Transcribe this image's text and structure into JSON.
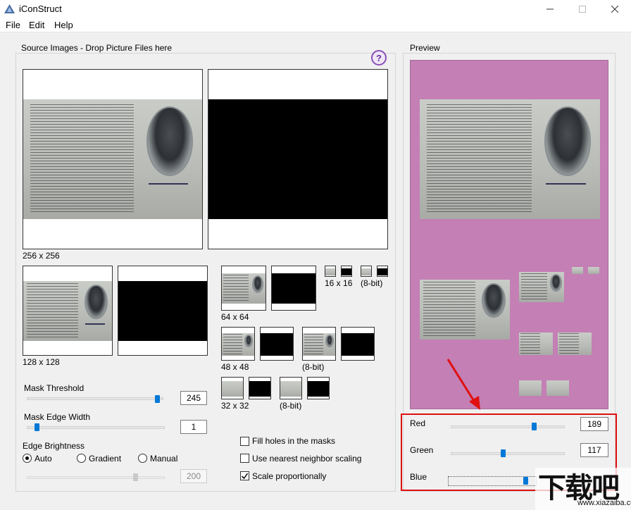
{
  "window": {
    "title": "iConStruct"
  },
  "menu": [
    {
      "label": "File"
    },
    {
      "label": "Edit"
    },
    {
      "label": "Help"
    }
  ],
  "source": {
    "group_title": "Source Images - Drop Picture Files here",
    "help_label": "?",
    "sizes": {
      "s256": "256 x 256",
      "s128": "128 x 128",
      "s64": "64 x 64",
      "s48": "48 x 48",
      "s32": "32 x 32",
      "s16": "16 x 16",
      "b8bit_16": "(8-bit)",
      "b8bit_48": "(8-bit)",
      "b8bit_32": "(8-bit)"
    }
  },
  "mask_threshold": {
    "label": "Mask Threshold",
    "value": "245",
    "level_fraction": 0.96
  },
  "mask_edge_width": {
    "label": "Mask Edge Width",
    "value": "1",
    "level_fraction": 0.05
  },
  "edge_brightness": {
    "label": "Edge Brightness",
    "options": [
      "Auto",
      "Gradient",
      "Manual"
    ],
    "selected": "Auto",
    "value": "200",
    "level_fraction": 0.78
  },
  "options": {
    "fill_holes": {
      "label": "Fill holes in the masks",
      "checked": false
    },
    "nearest_neighbor": {
      "label": "Use nearest neighbor scaling",
      "checked": false
    },
    "scale_proportionally": {
      "label": "Scale proportionally",
      "checked": true
    }
  },
  "preview": {
    "group_title": "Preview",
    "background_color": "#c47fb5",
    "red": {
      "label": "Red",
      "value": "189"
    },
    "green": {
      "label": "Green",
      "value": "117"
    },
    "blue": {
      "label": "Blue",
      "value": ""
    }
  },
  "watermark": {
    "main": "下载吧",
    "sub": "www.xiazaiba.com"
  },
  "colors": {
    "accent": "#0078d7",
    "highlight": "#e01010",
    "help": "#8a4fb8"
  }
}
